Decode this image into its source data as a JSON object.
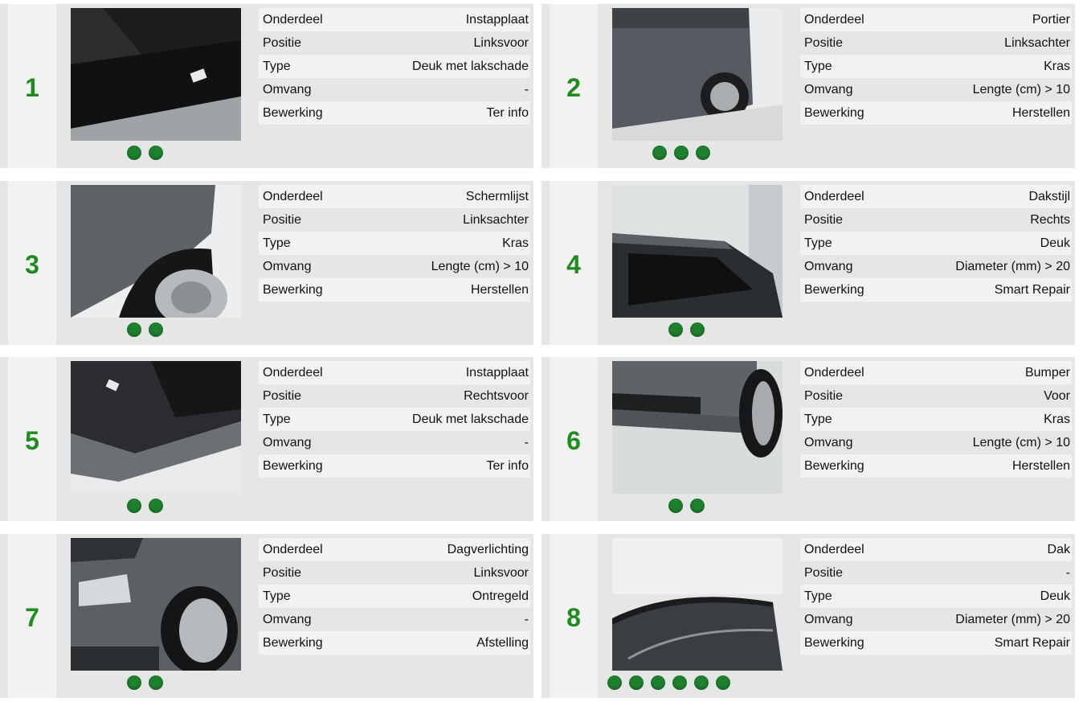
{
  "items": [
    {
      "number": "1",
      "dots": 2,
      "rows": [
        {
          "label": "Onderdeel",
          "value": "Instapplaat"
        },
        {
          "label": "Positie",
          "value": "Linksvoor"
        },
        {
          "label": "Type",
          "value": "Deuk met lakschade"
        },
        {
          "label": "Omvang",
          "value": "-"
        },
        {
          "label": "Bewerking",
          "value": "Ter info"
        }
      ]
    },
    {
      "number": "2",
      "dots": 3,
      "rows": [
        {
          "label": "Onderdeel",
          "value": "Portier"
        },
        {
          "label": "Positie",
          "value": "Linksachter"
        },
        {
          "label": "Type",
          "value": "Kras"
        },
        {
          "label": "Omvang",
          "value": "Lengte (cm) > 10"
        },
        {
          "label": "Bewerking",
          "value": "Herstellen"
        }
      ]
    },
    {
      "number": "3",
      "dots": 2,
      "rows": [
        {
          "label": "Onderdeel",
          "value": "Schermlijst"
        },
        {
          "label": "Positie",
          "value": "Linksachter"
        },
        {
          "label": "Type",
          "value": "Kras"
        },
        {
          "label": "Omvang",
          "value": "Lengte (cm) > 10"
        },
        {
          "label": "Bewerking",
          "value": "Herstellen"
        }
      ]
    },
    {
      "number": "4",
      "dots": 2,
      "rows": [
        {
          "label": "Onderdeel",
          "value": "Dakstijl"
        },
        {
          "label": "Positie",
          "value": "Rechts"
        },
        {
          "label": "Type",
          "value": "Deuk"
        },
        {
          "label": "Omvang",
          "value": "Diameter (mm) > 20"
        },
        {
          "label": "Bewerking",
          "value": "Smart Repair"
        }
      ]
    },
    {
      "number": "5",
      "dots": 2,
      "rows": [
        {
          "label": "Onderdeel",
          "value": "Instapplaat"
        },
        {
          "label": "Positie",
          "value": "Rechtsvoor"
        },
        {
          "label": "Type",
          "value": "Deuk met lakschade"
        },
        {
          "label": "Omvang",
          "value": "-"
        },
        {
          "label": "Bewerking",
          "value": "Ter info"
        }
      ]
    },
    {
      "number": "6",
      "dots": 2,
      "rows": [
        {
          "label": "Onderdeel",
          "value": "Bumper"
        },
        {
          "label": "Positie",
          "value": "Voor"
        },
        {
          "label": "Type",
          "value": "Kras"
        },
        {
          "label": "Omvang",
          "value": "Lengte (cm) > 10"
        },
        {
          "label": "Bewerking",
          "value": "Herstellen"
        }
      ]
    },
    {
      "number": "7",
      "dots": 2,
      "rows": [
        {
          "label": "Onderdeel",
          "value": "Dagverlichting"
        },
        {
          "label": "Positie",
          "value": "Linksvoor"
        },
        {
          "label": "Type",
          "value": "Ontregeld"
        },
        {
          "label": "Omvang",
          "value": "-"
        },
        {
          "label": "Bewerking",
          "value": "Afstelling"
        }
      ]
    },
    {
      "number": "8",
      "dots": 6,
      "rows": [
        {
          "label": "Onderdeel",
          "value": "Dak"
        },
        {
          "label": "Positie",
          "value": "-"
        },
        {
          "label": "Type",
          "value": "Deuk"
        },
        {
          "label": "Omvang",
          "value": "Diameter (mm) > 20"
        },
        {
          "label": "Bewerking",
          "value": "Smart Repair"
        }
      ]
    }
  ],
  "colors": {
    "number": "#1e8c1e",
    "dot": "#1e7f2e",
    "card": "#e6e6e6",
    "row_alt": "#f2f2f2"
  }
}
